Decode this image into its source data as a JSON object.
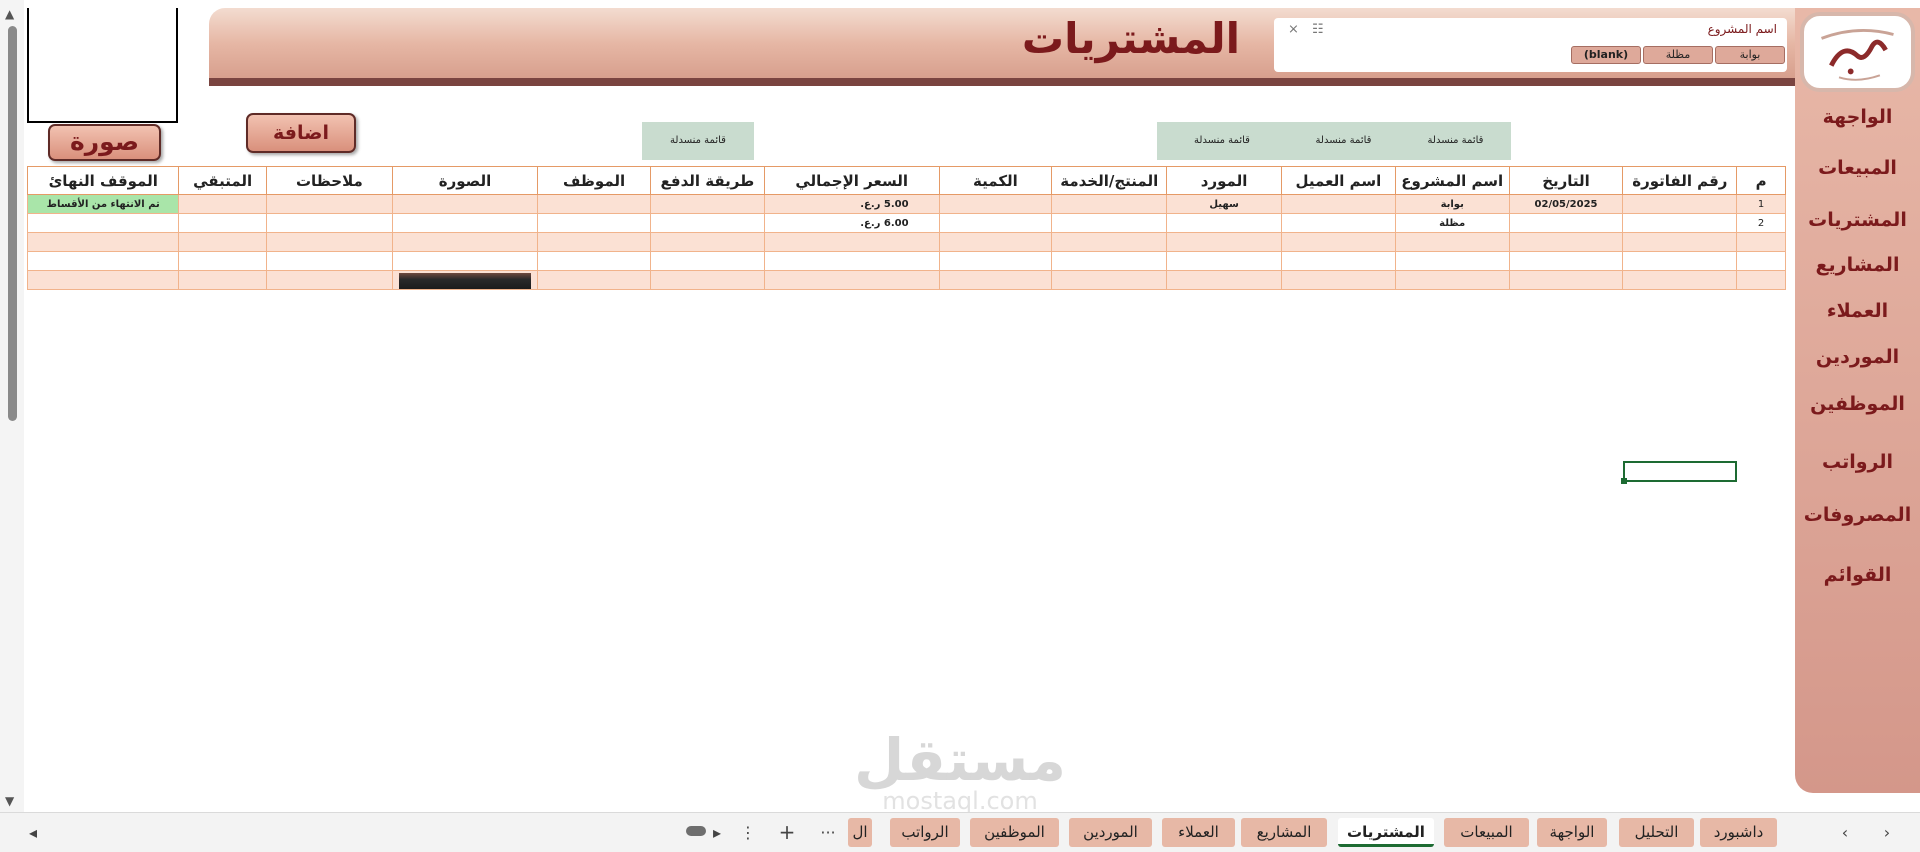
{
  "page": {
    "title": "المشتريات",
    "add_label": "اضافة",
    "image_label": "صورة"
  },
  "slicer": {
    "title": "اسم المشروع",
    "items": [
      "بوابة",
      "مظلة",
      "(blank)"
    ]
  },
  "nav": [
    "الواجهة",
    "المبيعات",
    "المشتريات",
    "المشاريع",
    "العملاء",
    "الموردين",
    "الموظفين",
    "الرواتب",
    "المصروفات",
    "القوائم"
  ],
  "dropdown_label": "قائمة منسدلة",
  "table": {
    "headers": [
      "م",
      "رقم الفاتورة",
      "التاريخ",
      "اسم المشروع",
      "اسم العميل",
      "المورد",
      "المنتج/الخدمة",
      "الكمية",
      "السعر الإجمالي",
      "طريقة الدفع",
      "الموظف",
      "الصورة",
      "ملاحظات",
      "المتبقي",
      "الموقف النهائ"
    ],
    "rows": [
      [
        "1",
        "",
        "02/05/2025",
        "بوابة",
        "",
        "سهيل",
        "",
        "",
        "5.00 ر.ع.",
        "",
        "",
        "",
        "",
        "",
        "تم الانتهاء من الأقساط"
      ],
      [
        "2",
        "",
        "",
        "مظلة",
        "",
        "",
        "",
        "",
        "6.00 ر.ع.",
        "",
        "",
        "",
        "",
        "",
        ""
      ],
      [
        "",
        "",
        "",
        "",
        "",
        "",
        "",
        "",
        "",
        "",
        "",
        "",
        "",
        "",
        ""
      ],
      [
        "",
        "",
        "",
        "",
        "",
        "",
        "",
        "",
        "",
        "",
        "",
        "",
        "",
        "",
        ""
      ],
      [
        "",
        "",
        "",
        "",
        "",
        "",
        "",
        "",
        "",
        "",
        "",
        "",
        "",
        "",
        ""
      ]
    ]
  },
  "tabs": [
    "داشبورد",
    "التحليل",
    "الواجهة",
    "المبيعات",
    "المشتريات",
    "المشاريع",
    "العملاء",
    "الموردين",
    "الموظفين",
    "الرواتب",
    "ال"
  ],
  "active_tab": "المشتريات",
  "watermark": {
    "main": "مستقل",
    "sub": "mostaql.com"
  },
  "colors": {
    "brand": "#7b1a1c",
    "panel": "#e2a99a",
    "header_border": "#e59a66",
    "row_fill": "#fbe1d4",
    "status_green": "#a9e5a9"
  },
  "icons": [
    "filter-multiselect-icon",
    "clear-filter-icon",
    "scroll-left-icon",
    "scroll-right-icon",
    "add-sheet-icon",
    "more-sheets-icon",
    "sheet-options-icon"
  ]
}
